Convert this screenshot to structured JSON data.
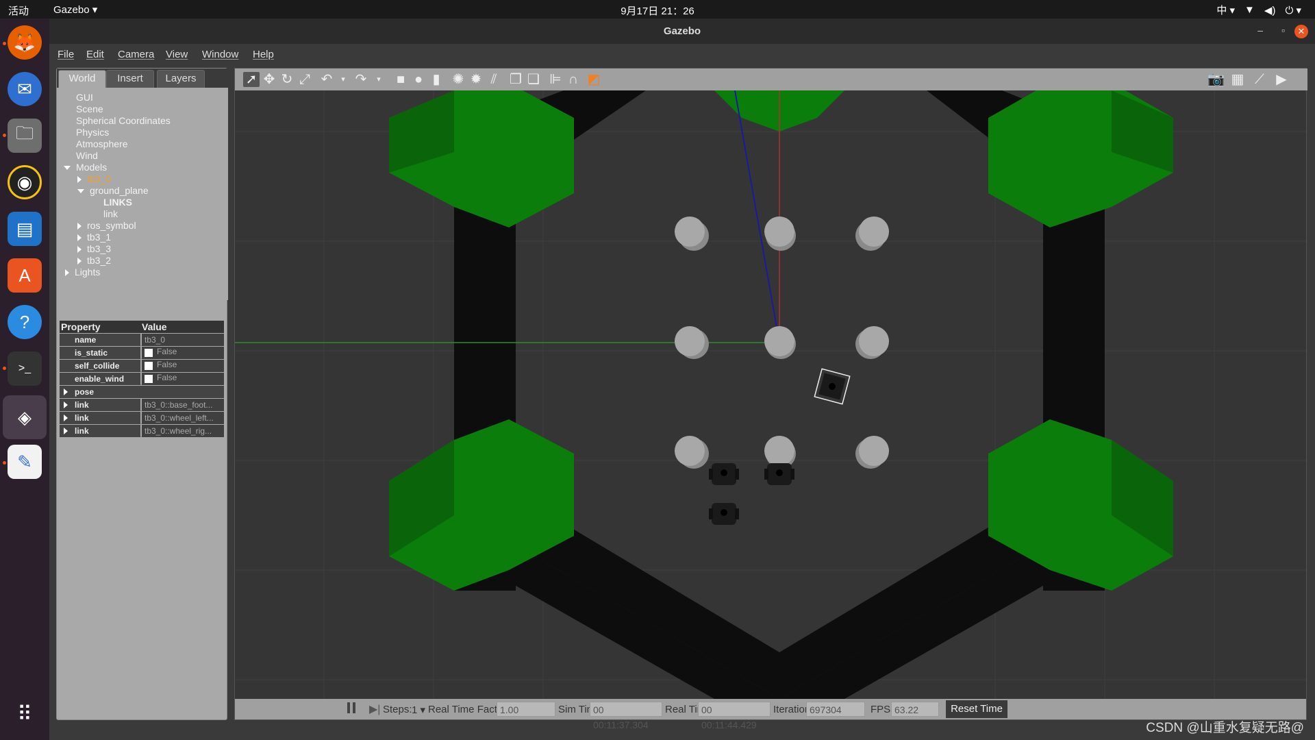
{
  "topbar": {
    "activities": "活动",
    "app_menu": "Gazebo ▾",
    "clock": "9月17日 21：26",
    "input_method": "中 ▾"
  },
  "dock": {
    "items": [
      "firefox-icon",
      "thunderbird-icon",
      "files-icon",
      "rhythmbox-icon",
      "writer-icon",
      "software-icon",
      "help-icon",
      "terminal-icon",
      "gazebo-icon",
      "text-editor-icon"
    ],
    "show_apps": "show-apps-icon"
  },
  "window": {
    "title": "Gazebo",
    "menu": [
      "File",
      "Edit",
      "Camera",
      "View",
      "Window",
      "Help"
    ]
  },
  "left_panel": {
    "tabs": [
      "World",
      "Insert",
      "Layers"
    ],
    "tree": {
      "gui": "GUI",
      "scene": "Scene",
      "spherical": "Spherical Coordinates",
      "physics": "Physics",
      "atmosphere": "Atmosphere",
      "wind": "Wind",
      "models": "Models",
      "tb3_0": "tb3_0",
      "ground_plane": "ground_plane",
      "links": "LINKS",
      "link": "link",
      "ros_symbol": "ros_symbol",
      "tb3_1": "tb3_1",
      "tb3_3": "tb3_3",
      "tb3_2": "tb3_2",
      "lights": "Lights"
    },
    "properties": {
      "header_property": "Property",
      "header_value": "Value",
      "rows": [
        {
          "key": "name",
          "value": "tb3_0"
        },
        {
          "key": "is_static",
          "value": "False"
        },
        {
          "key": "self_collide",
          "value": "False"
        },
        {
          "key": "enable_wind",
          "value": "False"
        },
        {
          "key": "pose",
          "value": ""
        },
        {
          "key": "link",
          "value": "tb3_0::base_foot..."
        },
        {
          "key": "link",
          "value": "tb3_0::wheel_left..."
        },
        {
          "key": "link",
          "value": "tb3_0::wheel_rig..."
        }
      ]
    }
  },
  "status": {
    "steps_label": "Steps:",
    "steps_value": "1 ▾",
    "rtf_label": "Real Time Factor:",
    "rtf_value": "1.00",
    "sim_label": "Sim Time:",
    "sim_value": "00 00:11:37.304",
    "real_label": "Real Time:",
    "real_value": "00 00:11:44.429",
    "iter_label": "Iterations:",
    "iter_value": "697304",
    "fps_label": "FPS:",
    "fps_value": "63.22",
    "reset": "Reset Time"
  },
  "watermark": "CSDN @山重水复疑无路@",
  "colors": {
    "accent": "#e95420",
    "selected_model": "#f0a030",
    "grass": "#0a7a0a",
    "wall": "#0d0d0d",
    "pillar": "#a8a8a8"
  }
}
